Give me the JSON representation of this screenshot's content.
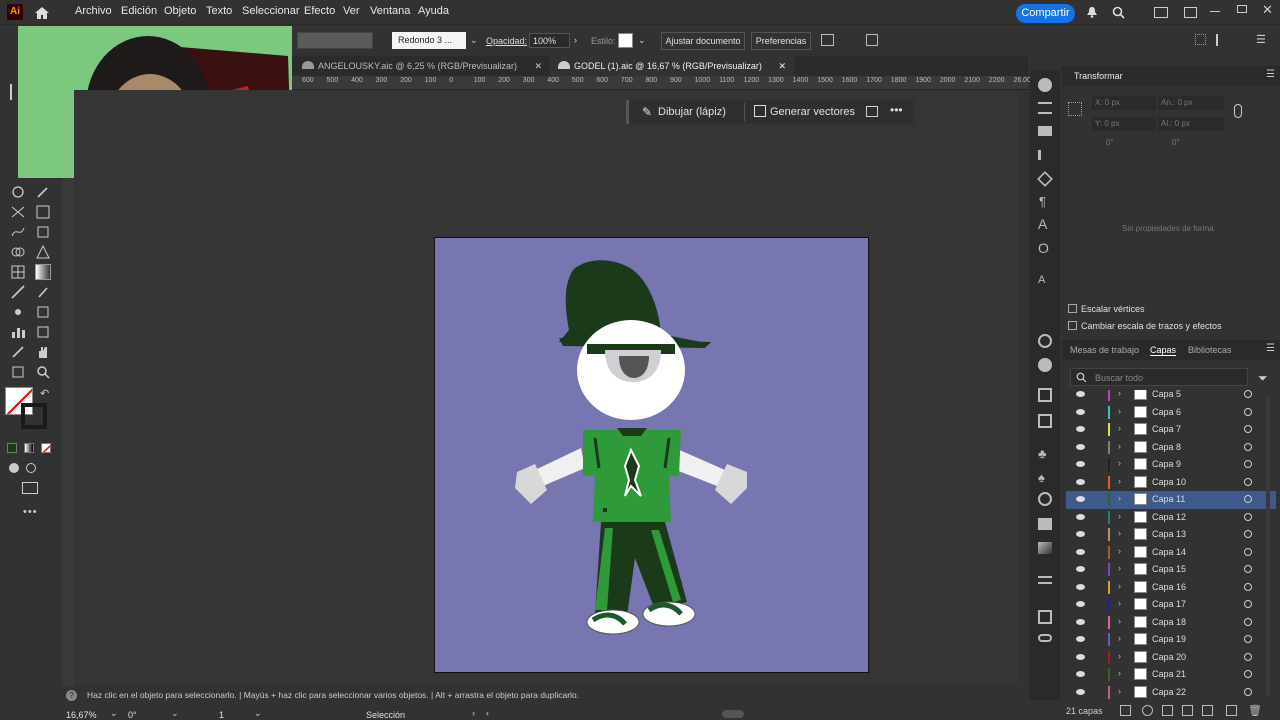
{
  "menubar": {
    "logo": "Ai",
    "items": [
      "Archivo",
      "Edición",
      "Objeto",
      "Texto",
      "Seleccionar",
      "Efecto",
      "Ver",
      "Ventana",
      "Ayuda"
    ],
    "share_label": "Compartir"
  },
  "controlbar": {
    "stroke_profile": "Redondo 3 ...",
    "opacity_label": "Opacidad:",
    "opacity_value": "100%",
    "style_label": "Estilo:",
    "adjust_doc": "Ajustar documento",
    "prefs": "Preferencias"
  },
  "tabs": [
    {
      "label": "ANGELOUSKY.aic @ 6,25 % (RGB/Previsualizar)"
    },
    {
      "label": "GODEL (1).aic @ 16,67 % (RGB/Previsualizar)"
    }
  ],
  "ruler_ticks": [
    "600",
    "500",
    "400",
    "300",
    "200",
    "100",
    "0",
    "100",
    "200",
    "300",
    "400",
    "500",
    "600",
    "700",
    "800",
    "900",
    "1000",
    "1100",
    "1200",
    "1300",
    "1400",
    "1500",
    "1600",
    "1700",
    "1800",
    "1900",
    "2000",
    "2100",
    "2200",
    "26.00"
  ],
  "context_bar": {
    "draw": "Dibujar (lápiz)",
    "generate": "Generar vectores"
  },
  "transform": {
    "title": "Transformar",
    "x": "X: 0 px",
    "y": "Y: 0 px",
    "w": "An.: 0 px",
    "h": "Al.: 0 px",
    "angle": "0°",
    "shear": "0°",
    "empty": "Sin propiedades de forma",
    "scale_corners": "Escalar vértices",
    "scale_strokes": "Cambiar escala de trazos y efectos"
  },
  "layers_panel": {
    "tabs": [
      "Mesas de trabajo",
      "Capas",
      "Bibliotecas"
    ],
    "search_placeholder": "Buscar todo",
    "count": "21 capas",
    "layers": [
      {
        "name": "Capa 5",
        "color": "#c040c0"
      },
      {
        "name": "Capa 6",
        "color": "#40c0c0"
      },
      {
        "name": "Capa 7",
        "color": "#e0e040"
      },
      {
        "name": "Capa 8",
        "color": "#808080"
      },
      {
        "name": "Capa 9",
        "color": "#202020"
      },
      {
        "name": "Capa 10",
        "color": "#e06020"
      },
      {
        "name": "Capa 11",
        "color": "#306030",
        "selected": true
      },
      {
        "name": "Capa 12",
        "color": "#208080"
      },
      {
        "name": "Capa 13",
        "color": "#c09060"
      },
      {
        "name": "Capa 14",
        "color": "#a06030"
      },
      {
        "name": "Capa 15",
        "color": "#8040c0"
      },
      {
        "name": "Capa 16",
        "color": "#e0a020"
      },
      {
        "name": "Capa 17",
        "color": "#2020a0"
      },
      {
        "name": "Capa 18",
        "color": "#e060a0"
      },
      {
        "name": "Capa 19",
        "color": "#6060c0"
      },
      {
        "name": "Capa 20",
        "color": "#a02020"
      },
      {
        "name": "Capa 21",
        "color": "#406020"
      },
      {
        "name": "Capa 22",
        "color": "#c06080"
      }
    ]
  },
  "status": {
    "hint": "Haz clic en el objeto para seleccionarlo.  |  Mayús + haz clic para seleccionar varios objetos.  |  Alt + arrastra el objeto para duplicarlo.",
    "zoom": "16,67%",
    "rotation": "0°",
    "page": "1",
    "tool": "Selección"
  },
  "colors": {
    "accent": "#1473e6",
    "artboard": "#7776b0",
    "hat": "#1a3a1a",
    "shirt": "#2e9a3a",
    "pants": "#1a3a1a"
  }
}
